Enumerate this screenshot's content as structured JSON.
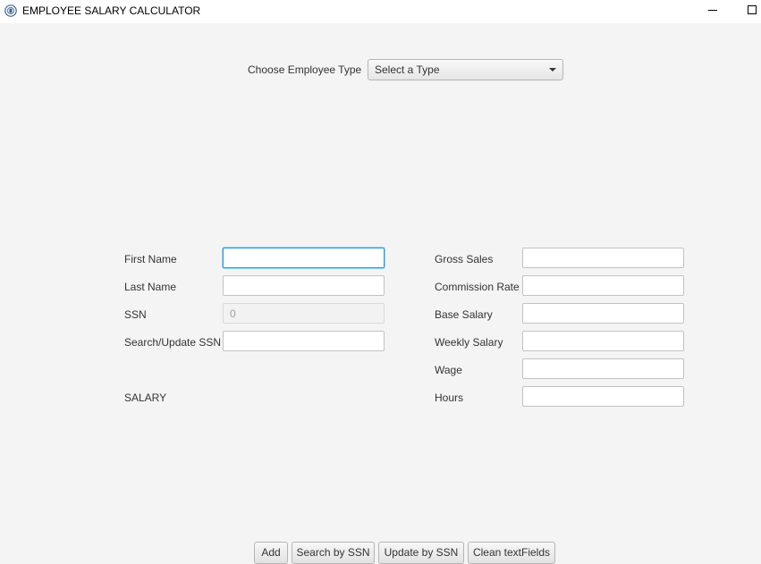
{
  "window": {
    "title": "EMPLOYEE SALARY CALCULATOR",
    "app_icon": "app-globe-icon"
  },
  "type_chooser": {
    "label": "Choose Employee Type",
    "selected": "Select a Type"
  },
  "left_form": {
    "first_name_label": "First Name",
    "first_name_value": "",
    "last_name_label": "Last Name",
    "last_name_value": "",
    "ssn_label": "SSN",
    "ssn_value": "0",
    "search_ssn_label": "Search/Update SSN",
    "search_ssn_value": "",
    "salary_label": "SALARY"
  },
  "right_form": {
    "gross_sales_label": "Gross Sales",
    "gross_sales_value": "",
    "commission_rate_label": "Commission Rate",
    "commission_rate_value": "",
    "base_salary_label": "Base Salary",
    "base_salary_value": "",
    "weekly_salary_label": "Weekly Salary",
    "weekly_salary_value": "",
    "wage_label": "Wage",
    "wage_value": "",
    "hours_label": "Hours",
    "hours_value": ""
  },
  "buttons": {
    "add": "Add",
    "search": "Search by SSN",
    "update": "Update by SSN",
    "clean": "Clean textFields"
  },
  "colors": {
    "background": "#f4f4f4",
    "focus_border": "#2b9cd6"
  }
}
